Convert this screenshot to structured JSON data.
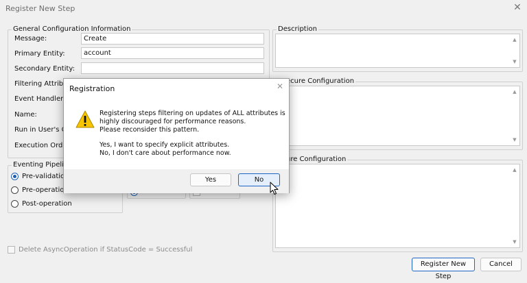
{
  "window": {
    "title": "Register New Step",
    "close_glyph": "✕"
  },
  "general": {
    "group_label": "General Configuration Information",
    "message_label": "Message:",
    "message_value": "Create",
    "primary_label": "Primary Entity:",
    "primary_value": "account",
    "secondary_label": "Secondary Entity:",
    "secondary_value": "",
    "filtering_label": "Filtering Attributes:",
    "event_handler_label": "Event Handler:",
    "name_label": "Name:",
    "run_in_context_label": "Run in User's Cor",
    "execution_order_label": "Execution Order:"
  },
  "pipeline": {
    "group_label": "Eventing Pipeline S",
    "options": [
      "Pre-validation",
      "Pre-operation",
      "Post-operation"
    ],
    "selected_index": 0
  },
  "right": {
    "description_label": "Description",
    "unsecure_label": "ecure Configuration",
    "secure_label": "ure Configuration"
  },
  "delete_async": {
    "label": "Delete AsyncOperation if StatusCode = Successful",
    "checked": false
  },
  "buttons": {
    "register": "Register New Step",
    "cancel": "Cancel"
  },
  "dialog": {
    "title": "Registration",
    "close_glyph": "✕",
    "message_lines": [
      "Registering steps filtering on updates of ALL attributes is",
      "highly discouraged for performance reasons.",
      "Please reconsider this pattern.",
      "",
      "Yes, I want to specify explicit attributes.",
      "No, I don't care about performance now."
    ],
    "yes_label": "Yes",
    "no_label": "No",
    "icon": "warning-icon"
  },
  "colors": {
    "accent": "#1e63c6",
    "warning_fill": "#f7c600"
  }
}
